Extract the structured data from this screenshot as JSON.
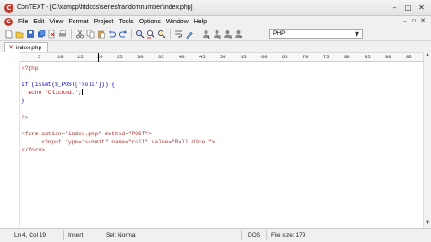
{
  "window": {
    "app_icon": "C",
    "title": "ConTEXT - [C:\\xampp\\htdocs\\series\\randomnumber\\index.php]",
    "controls": [
      "–",
      "□",
      "✕"
    ]
  },
  "menu": {
    "icon": "C",
    "items": [
      "File",
      "Edit",
      "View",
      "Format",
      "Project",
      "Tools",
      "Options",
      "Window",
      "Help"
    ],
    "right_controls": [
      "–",
      "▫",
      "✕"
    ]
  },
  "toolbar": {
    "buttons": [
      "new-file",
      "open-folder",
      "save",
      "save-all",
      "close",
      "print",
      "cut",
      "copy",
      "paste",
      "undo",
      "redo",
      "find",
      "replace",
      "find-next",
      "word-wrap",
      "bookmark",
      "user-command-1",
      "user-command-2",
      "user-command-3",
      "user-command-4"
    ],
    "language": "PHP"
  },
  "tab": {
    "close_glyph": "✕",
    "label": "index.php"
  },
  "ruler": {
    "marks": [
      "5",
      "10",
      "15",
      "20",
      "25",
      "30",
      "35",
      "40",
      "45",
      "50",
      "55",
      "60",
      "65",
      "70",
      "75",
      "80",
      "85",
      "90",
      "95"
    ]
  },
  "code": {
    "lines": [
      "<?php",
      "",
      "if (isset($_POST['roll'])) {",
      "  echo 'Clicked.';",
      "}",
      "",
      "?>",
      "",
      "<form action=\"index.php\" method=\"POST\">",
      "      <input type=\"submit\" name=\"roll\" value=\"Roll dice.\">",
      "</form>"
    ]
  },
  "status": {
    "position": "Ln 4, Col 19",
    "mode": "Insert",
    "selection": "Sel: Normal",
    "line_ending": "DOS",
    "file_size": "File size: 179"
  },
  "colors": {
    "keyword": "#0000aa",
    "string": "#cc0000",
    "variable": "#0000cc",
    "tag": "#aa3333"
  }
}
